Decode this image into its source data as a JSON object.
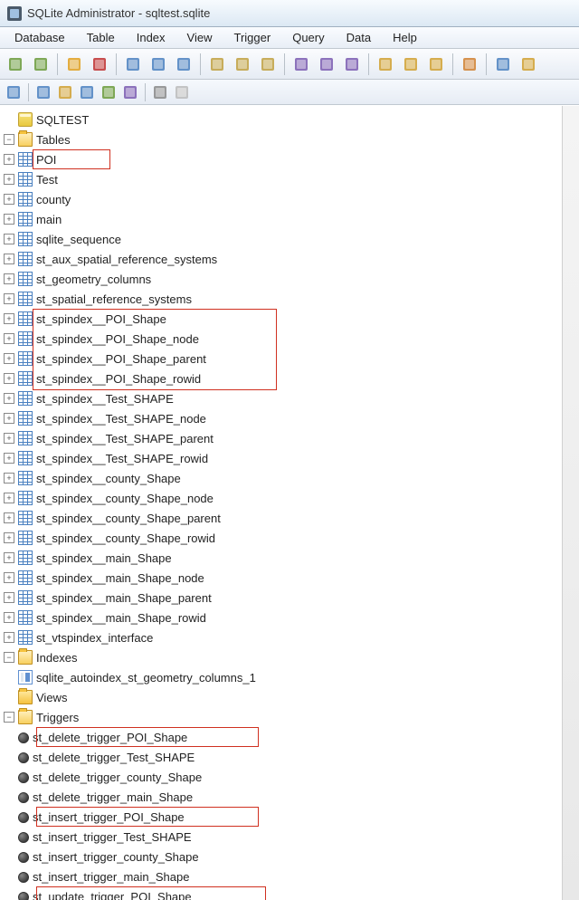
{
  "window": {
    "title": "SQLite Administrator - sqltest.sqlite"
  },
  "menu": [
    "Database",
    "Table",
    "Index",
    "View",
    "Trigger",
    "Query",
    "Data",
    "Help"
  ],
  "toolbar_icons": [
    "db-add-icon",
    "db-remove-icon",
    "sep",
    "refresh-icon",
    "cancel-icon",
    "sep",
    "grid-icon",
    "grid-edit-icon",
    "grid-form-icon",
    "sep",
    "sql-icon",
    "sql-run-icon",
    "sql-export-icon",
    "sep",
    "schema-icon",
    "schema-plus-icon",
    "schema-minus-icon",
    "sep",
    "vacuum-icon",
    "compact-icon",
    "analyze-icon",
    "sep",
    "export-icon",
    "sep",
    "save-icon",
    "reload-icon"
  ],
  "tab_toolbar_icons": [
    "tree-icon",
    "sep",
    "grid-view-icon",
    "form-view-icon",
    "card-view-icon",
    "col-icon",
    "detail-icon",
    "sep",
    "page-icon",
    "blank-icon"
  ],
  "tree": {
    "root": "SQLTEST",
    "folders": {
      "tables": {
        "label": "Tables",
        "items": [
          "POI",
          "Test",
          "county",
          "main",
          "sqlite_sequence",
          "st_aux_spatial_reference_systems",
          "st_geometry_columns",
          "st_spatial_reference_systems",
          "st_spindex__POI_Shape",
          "st_spindex__POI_Shape_node",
          "st_spindex__POI_Shape_parent",
          "st_spindex__POI_Shape_rowid",
          "st_spindex__Test_SHAPE",
          "st_spindex__Test_SHAPE_node",
          "st_spindex__Test_SHAPE_parent",
          "st_spindex__Test_SHAPE_rowid",
          "st_spindex__county_Shape",
          "st_spindex__county_Shape_node",
          "st_spindex__county_Shape_parent",
          "st_spindex__county_Shape_rowid",
          "st_spindex__main_Shape",
          "st_spindex__main_Shape_node",
          "st_spindex__main_Shape_parent",
          "st_spindex__main_Shape_rowid",
          "st_vtspindex_interface"
        ]
      },
      "indexes": {
        "label": "Indexes",
        "items": [
          "sqlite_autoindex_st_geometry_columns_1"
        ]
      },
      "views": {
        "label": "Views",
        "items": []
      },
      "triggers": {
        "label": "Triggers",
        "items": [
          "st_delete_trigger_POI_Shape",
          "st_delete_trigger_Test_SHAPE",
          "st_delete_trigger_county_Shape",
          "st_delete_trigger_main_Shape",
          "st_insert_trigger_POI_Shape",
          "st_insert_trigger_Test_SHAPE",
          "st_insert_trigger_county_Shape",
          "st_insert_trigger_main_Shape",
          "st_update_trigger_POI_Shape"
        ]
      }
    }
  },
  "highlights": {
    "table_single": [
      0
    ],
    "table_group_start": 8,
    "trigger_singles": [
      0,
      4,
      8
    ]
  }
}
